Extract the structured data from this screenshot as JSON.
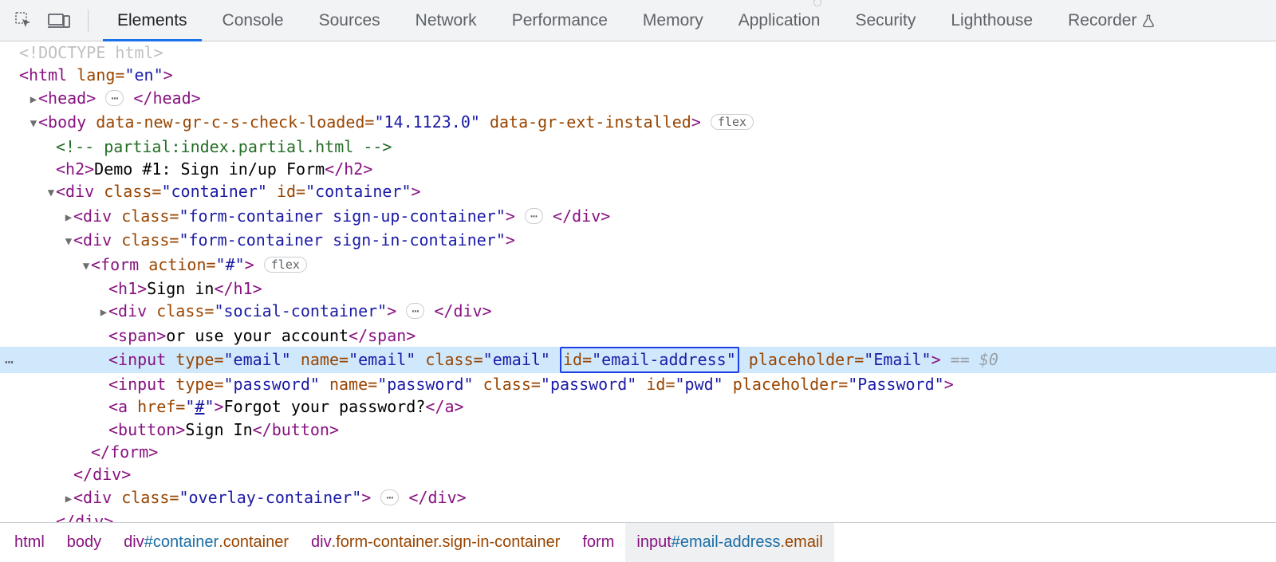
{
  "tabs": {
    "t0": "Elements",
    "t1": "Console",
    "t2": "Sources",
    "t3": "Network",
    "t4": "Performance",
    "t5": "Memory",
    "t6": "Application",
    "t7": "Security",
    "t8": "Lighthouse",
    "t9": "Recorder"
  },
  "pills": {
    "dots": "⋯",
    "flex": "flex"
  },
  "dom": {
    "doctype": "<!DOCTYPE html>",
    "html_open": "<",
    "html_name": "html",
    "html_attr_lang": " lang=",
    "html_lang_val": "\"en\"",
    "html_gt": ">",
    "head_open": "<",
    "head_name": "head",
    "head_gt": ">",
    "head_close": "</head>",
    "body_open": "<",
    "body_name": "body",
    "body_a1": " data-new-gr-c-s-check-loaded=",
    "body_v1": "\"14.1123.0\"",
    "body_a2": " data-gr-ext-installed",
    "body_gt": ">",
    "comment": "<!-- partial:index.partial.html -->",
    "h2_open": "<h2>",
    "h2_text": "Demo #1: Sign in/up Form",
    "h2_close": "</h2>",
    "div_container_open": "<",
    "div": "div",
    "class_attr": " class=",
    "id_attr": " id=",
    "container_class": "\"container\"",
    "container_id": "\"container\"",
    "gt": ">",
    "signup_class": "\"form-container sign-up-container\"",
    "signin_class": "\"form-container sign-in-container\"",
    "form_open": "<",
    "form_name": "form",
    "form_action_attr": " action=",
    "form_action_val": "\"#\"",
    "h1_open": "<h1>",
    "h1_text": "Sign in",
    "h1_close": "</h1>",
    "social_class": "\"social-container\"",
    "span_open": "<span>",
    "span_text": "or use your account",
    "span_close": "</span>",
    "input": "input",
    "type_attr": " type=",
    "name_attr": " name=",
    "placeholder_attr": " placeholder=",
    "email_type": "\"email\"",
    "email_name": "\"email\"",
    "email_cls": "\"email\"",
    "email_id": "\"email-address\"",
    "email_ph": "\"Email\"",
    "pwd_type": "\"password\"",
    "pwd_name": "\"password\"",
    "pwd_cls": "\"password\"",
    "pwd_id": "\"pwd\"",
    "pwd_ph": "\"Password\"",
    "a_open": "<",
    "a_name": "a",
    "href_attr": " href=",
    "href_val": "\"",
    "href_hash": "#",
    "href_end": "\"",
    "a_text": "Forgot your password?",
    "a_close": "</a>",
    "btn_open": "<button>",
    "btn_text": "Sign In",
    "btn_close": "</button>",
    "form_close": "</form>",
    "div_close": "</div>",
    "overlay_class": "\"overlay-container\"",
    "sel_eq": " == ",
    "sel_dollar": "$0"
  },
  "crumbs": {
    "c0": "html",
    "c1": "body",
    "c2_tag": "div",
    "c2_id": "#container",
    "c2_cls": ".container",
    "c3_tag": "div",
    "c3_cls": ".form-container.sign-in-container",
    "c4": "form",
    "c5_tag": "input",
    "c5_id": "#email-address",
    "c5_cls": ".email"
  }
}
